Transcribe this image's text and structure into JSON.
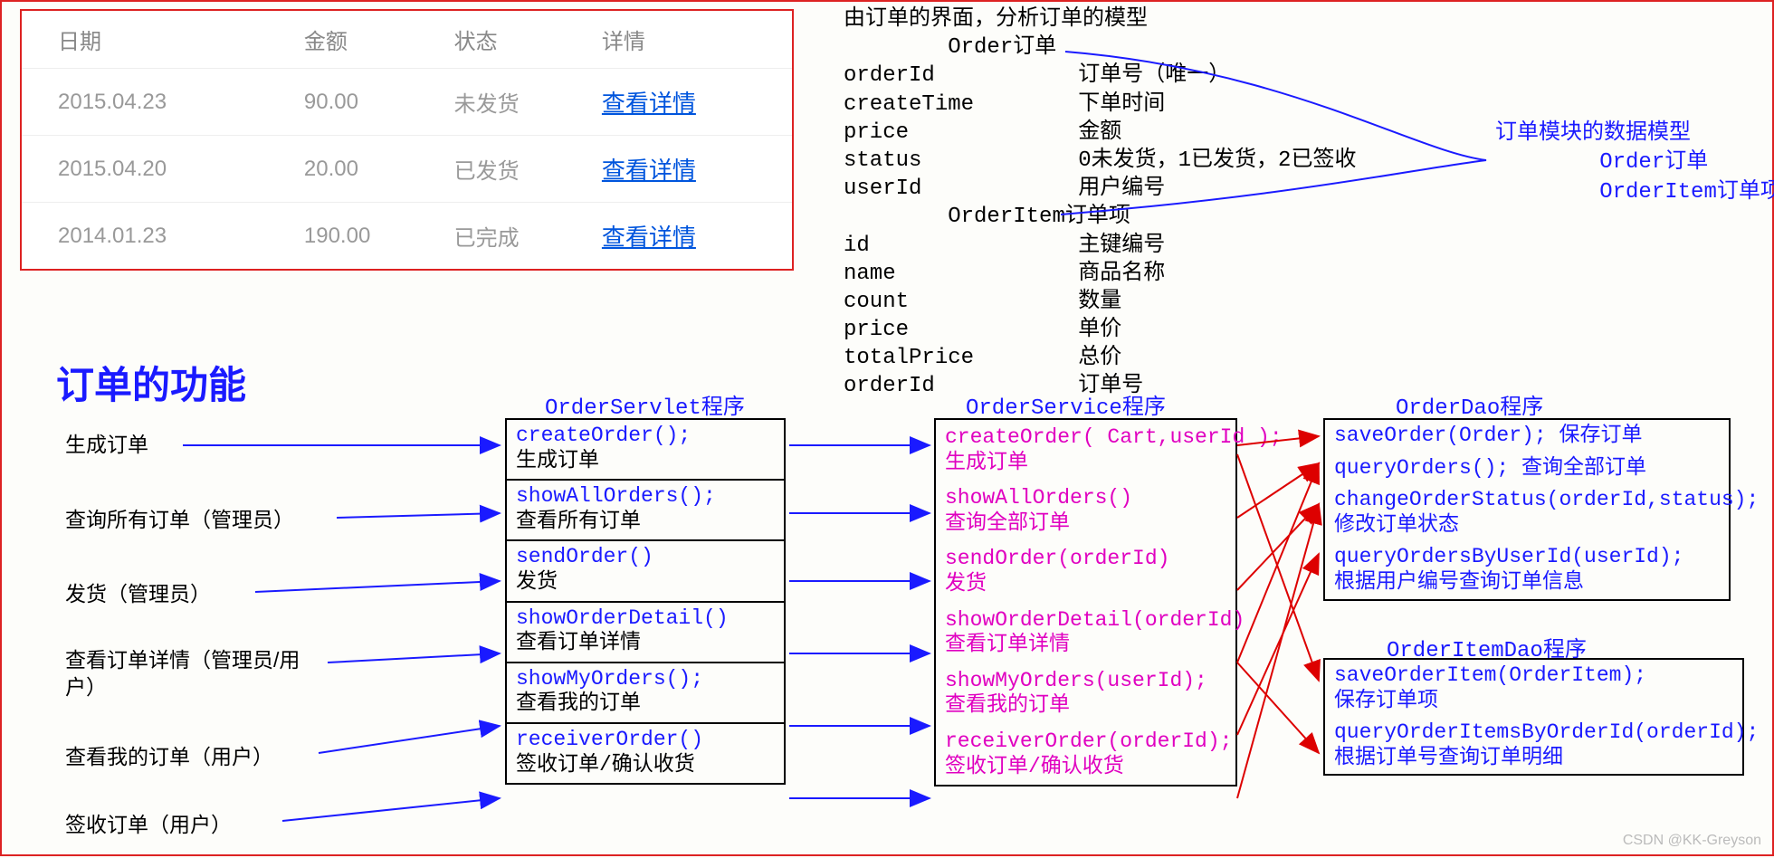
{
  "table": {
    "headers": [
      "日期",
      "金额",
      "状态",
      "详情"
    ],
    "rows": [
      {
        "date": "2015.04.23",
        "amount": "90.00",
        "status": "未发货",
        "link": "查看详情"
      },
      {
        "date": "2015.04.20",
        "amount": "20.00",
        "status": "已发货",
        "link": "查看详情"
      },
      {
        "date": "2014.01.23",
        "amount": "190.00",
        "status": "已完成",
        "link": "查看详情"
      }
    ]
  },
  "analysis": {
    "title": "由订单的界面，分析订单的模型",
    "order_hdr": "Order订单",
    "order_fields": [
      {
        "name": "orderId",
        "desc": "订单号（唯一）"
      },
      {
        "name": "createTime",
        "desc": "下单时间"
      },
      {
        "name": "price",
        "desc": "金额"
      },
      {
        "name": "status",
        "desc": "0未发货，1已发货，2已签收"
      },
      {
        "name": "userId",
        "desc": "用户编号"
      }
    ],
    "item_hdr": "OrderItem订单项",
    "item_fields": [
      {
        "name": "id",
        "desc": "主键编号"
      },
      {
        "name": "name",
        "desc": "商品名称"
      },
      {
        "name": "count",
        "desc": "数量"
      },
      {
        "name": "price",
        "desc": "单价"
      },
      {
        "name": "totalPrice",
        "desc": "总价"
      },
      {
        "name": "orderId",
        "desc": "订单号"
      }
    ],
    "callout": "订单模块的数据模型\n        Order订单\n        OrderItem订单项"
  },
  "func_title": "订单的功能",
  "actions": [
    "生成订单",
    "查询所有订单（管理员）",
    "发货（管理员）",
    "查看订单详情（管理员/用\n户）",
    "查看我的订单（用户）",
    "签收订单（用户）"
  ],
  "servlet": {
    "title": "OrderServlet程序",
    "items": [
      {
        "sig": "createOrder();",
        "sub": "生成订单"
      },
      {
        "sig": "showAllOrders();",
        "sub": "查看所有订单"
      },
      {
        "sig": "sendOrder()",
        "sub": "发货"
      },
      {
        "sig": "showOrderDetail()",
        "sub": "查看订单详情"
      },
      {
        "sig": "showMyOrders();",
        "sub": "查看我的订单"
      },
      {
        "sig": "receiverOrder()",
        "sub": "签收订单/确认收货"
      }
    ]
  },
  "service": {
    "title": "OrderService程序",
    "items": [
      {
        "sig": "createOrder( Cart,userId );",
        "sub": "生成订单"
      },
      {
        "sig": "showAllOrders()",
        "sub": "查询全部订单"
      },
      {
        "sig": "sendOrder(orderId)",
        "sub": "发货"
      },
      {
        "sig": "showOrderDetail(orderId)",
        "sub": "查看订单详情"
      },
      {
        "sig": "showMyOrders(userId);",
        "sub": "查看我的订单"
      },
      {
        "sig": "receiverOrder(orderId);",
        "sub": "签收订单/确认收货"
      }
    ]
  },
  "orderDao": {
    "title": "OrderDao程序",
    "items": [
      {
        "sig": "saveOrder(Order); 保存订单",
        "sub": ""
      },
      {
        "sig": "queryOrders(); 查询全部订单",
        "sub": ""
      },
      {
        "sig": "changeOrderStatus(orderId,status);",
        "sub": "修改订单状态"
      },
      {
        "sig": "queryOrdersByUserId(userId);",
        "sub": "根据用户编号查询订单信息"
      }
    ]
  },
  "itemDao": {
    "title": "OrderItemDao程序",
    "items": [
      {
        "sig": "saveOrderItem(OrderItem);",
        "sub": "保存订单项"
      },
      {
        "sig": "queryOrderItemsByOrderId(orderId);",
        "sub": "根据订单号查询订单明细"
      }
    ]
  },
  "watermark": "CSDN @KK-Greyson"
}
